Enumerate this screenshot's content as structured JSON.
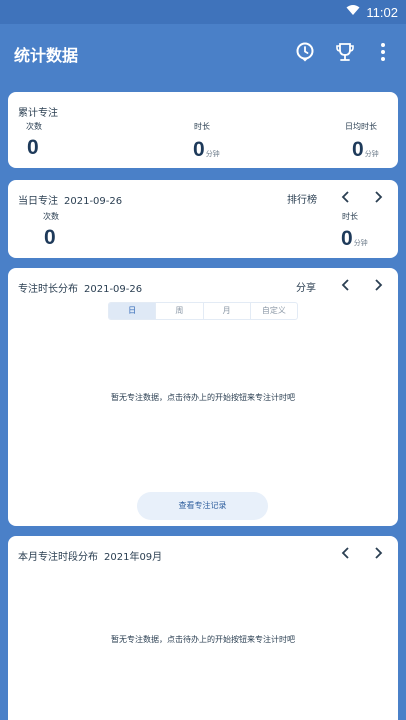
{
  "status_bar": {
    "time": "11:02"
  },
  "app_bar": {
    "title": "统计数据",
    "actions": [
      "clock-icon",
      "trophy-icon",
      "more-vertical-icon"
    ]
  },
  "colors": {
    "primary": "#4a80c8",
    "card": "#ffffff",
    "segment_active": "#dfe9f6",
    "button_bg": "#e8f0fa"
  },
  "total_focus": {
    "title": "累计专注",
    "count_label": "次数",
    "count_value": "0",
    "duration_label": "时长",
    "duration_value": "0",
    "duration_unit": "分钟",
    "daily_avg_label": "日均时长",
    "daily_avg_value": "0",
    "daily_avg_unit": "分钟"
  },
  "today_focus": {
    "title": "当日专注",
    "date": "2021-09-26",
    "ranking_label": "排行榜",
    "count_label": "次数",
    "count_value": "0",
    "duration_label": "时长",
    "duration_value": "0",
    "duration_unit": "分钟"
  },
  "distribution": {
    "title": "专注时长分布",
    "date": "2021-09-26",
    "share_label": "分享",
    "tabs": [
      "日",
      "周",
      "月",
      "自定义"
    ],
    "active_tab": "日",
    "empty_text": "暂无专注数据，点击待办上的开始按钮来专注计时吧",
    "record_button": "查看专注记录"
  },
  "monthly": {
    "title": "本月专注时段分布",
    "date": "2021年09月",
    "empty_text": "暂无专注数据，点击待办上的开始按钮来专注计时吧"
  }
}
